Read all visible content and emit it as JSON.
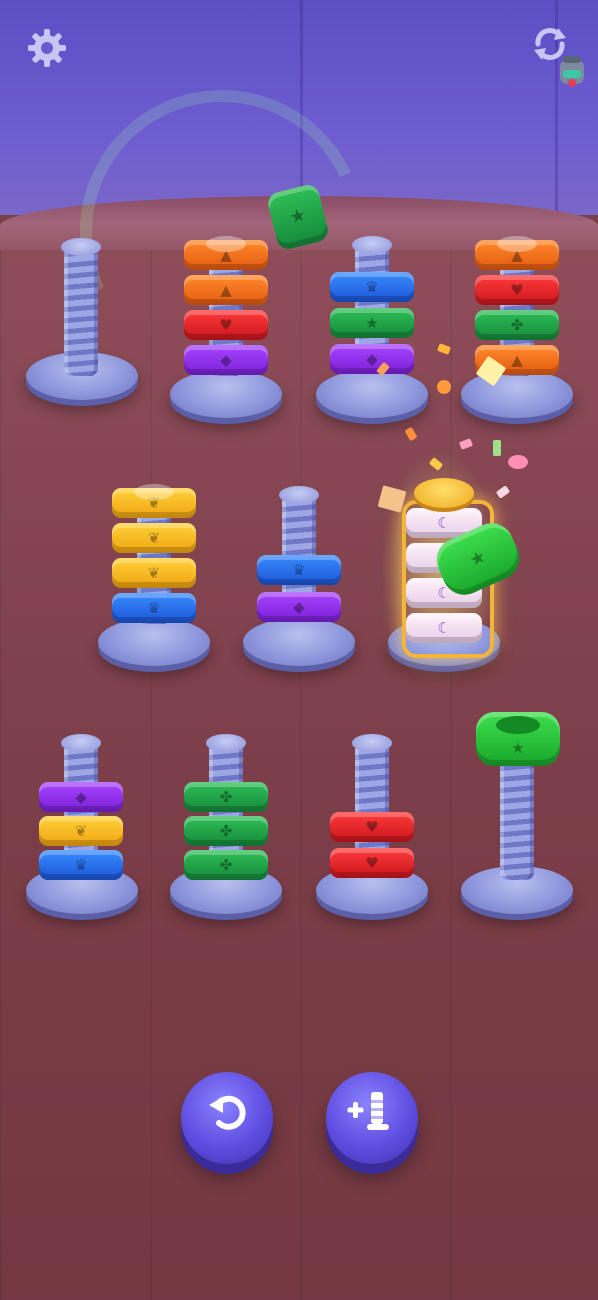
{
  "top_bar": {
    "settings_icon": "gear-icon",
    "restart_icon": "refresh-icon",
    "bonus_icon": "jar-icon"
  },
  "colors": {
    "orange": "#ff7a1f",
    "red": "#e5202a",
    "purple": "#8f2ff0",
    "blue": "#2a6ff0",
    "green": "#22a84a",
    "yellow": "#ffc021",
    "white": "#f7e4f3",
    "bright_green": "#2fd23d"
  },
  "boards": [
    {
      "id": "screw-1",
      "nuts": []
    },
    {
      "id": "screw-2",
      "nuts": [
        "orange",
        "orange",
        "red",
        "purple"
      ]
    },
    {
      "id": "screw-3",
      "nuts": [
        "blue",
        "green",
        "purple"
      ]
    },
    {
      "id": "screw-4",
      "nuts": [
        "orange",
        "red",
        "green",
        "orange"
      ]
    },
    {
      "id": "screw-5",
      "nuts": [
        "yellow",
        "yellow",
        "yellow",
        "blue"
      ]
    },
    {
      "id": "screw-6",
      "nuts": [
        "blue",
        "purple"
      ]
    },
    {
      "id": "screw-7",
      "nuts": [
        "white",
        "white",
        "white",
        "white"
      ],
      "state": "completed"
    },
    {
      "id": "screw-8",
      "nuts": [
        "purple",
        "yellow",
        "blue"
      ]
    },
    {
      "id": "screw-9",
      "nuts": [
        "green",
        "green",
        "green"
      ]
    },
    {
      "id": "screw-10",
      "nuts": [
        "red",
        "red"
      ]
    },
    {
      "id": "screw-11",
      "nuts": [
        "bright_green"
      ]
    }
  ],
  "bottom_bar": {
    "undo_icon": "undo-icon",
    "add_screw_icon": "add-screw-icon"
  }
}
